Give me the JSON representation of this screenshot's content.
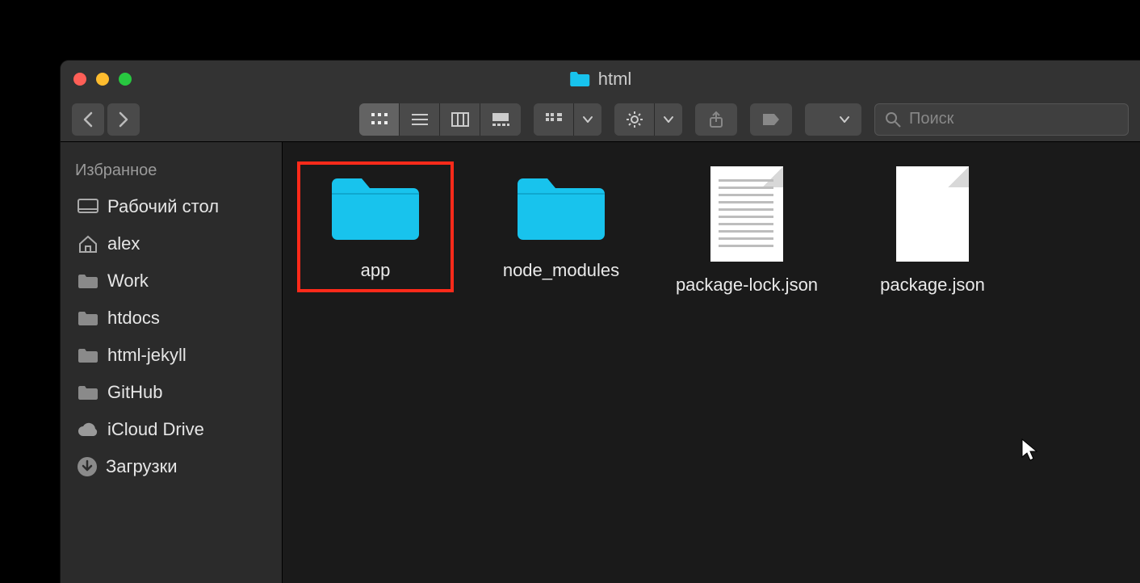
{
  "window": {
    "title": "html"
  },
  "toolbar": {
    "search_placeholder": "Поиск"
  },
  "sidebar": {
    "heading": "Избранное",
    "items": [
      {
        "icon": "desktop-icon",
        "label": "Рабочий стол"
      },
      {
        "icon": "home-icon",
        "label": "alex"
      },
      {
        "icon": "folder-icon",
        "label": "Work"
      },
      {
        "icon": "folder-icon",
        "label": "htdocs"
      },
      {
        "icon": "folder-icon",
        "label": "html-jekyll"
      },
      {
        "icon": "folder-icon",
        "label": "GitHub"
      },
      {
        "icon": "cloud-icon",
        "label": "iCloud Drive"
      },
      {
        "icon": "download-icon",
        "label": "Загрузки"
      }
    ]
  },
  "content": {
    "items": [
      {
        "type": "folder",
        "label": "app",
        "highlighted": true
      },
      {
        "type": "folder",
        "label": "node_modules",
        "highlighted": false
      },
      {
        "type": "file",
        "label": "package-lock.json",
        "highlighted": false
      },
      {
        "type": "file",
        "label": "package.json",
        "highlighted": false
      }
    ]
  },
  "colors": {
    "folder": "#18c3ed",
    "highlight": "#ff2a1a"
  }
}
